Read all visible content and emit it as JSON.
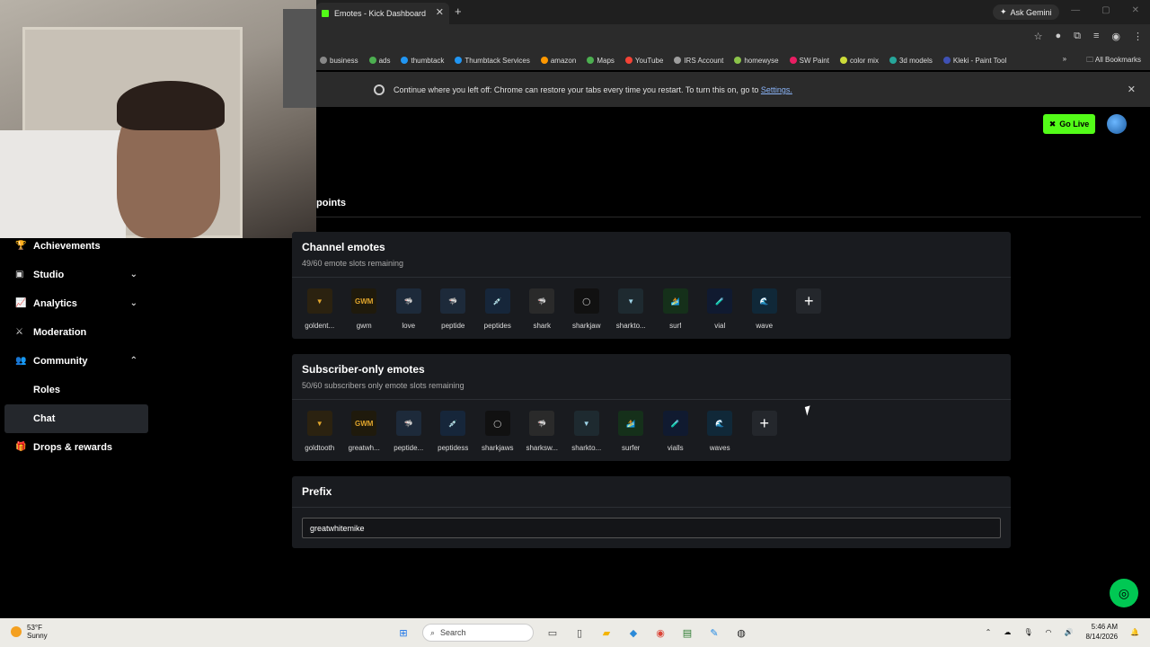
{
  "browser": {
    "tab_title": "Emotes - Kick Dashboard",
    "tab_close": "✕",
    "new_tab": "+",
    "ask_gemini": "Ask Gemini",
    "bookmarks": [
      {
        "label": "business",
        "color": "#888888"
      },
      {
        "label": "ads",
        "color": "#4caf50"
      },
      {
        "label": "thumbtack",
        "color": "#2196f3"
      },
      {
        "label": "Thumbtack Services",
        "color": "#2196f3"
      },
      {
        "label": "amazon",
        "color": "#ff9800"
      },
      {
        "label": "Maps",
        "color": "#4caf50"
      },
      {
        "label": "YouTube",
        "color": "#f44336"
      },
      {
        "label": "IRS Account",
        "color": "#9e9e9e"
      },
      {
        "label": "homewyse",
        "color": "#8bc34a"
      },
      {
        "label": "SW Paint",
        "color": "#e91e63"
      },
      {
        "label": "color mix",
        "color": "#cddc39"
      },
      {
        "label": "3d models",
        "color": "#26a69a"
      },
      {
        "label": "Kleki - Paint Tool",
        "color": "#3f51b5"
      }
    ],
    "bookmarks_overflow": "»",
    "all_bookmarks": "All Bookmarks",
    "infobar_text": "Continue where you left off: Chrome can restore your tabs every time you restart. To turn this on, go to ",
    "infobar_link": "Settings.",
    "infobar_close": "✕"
  },
  "header": {
    "go_live": "Go Live"
  },
  "section_label": "points",
  "sidebar": {
    "items": [
      {
        "label": "Achievements",
        "icon": "trophy-icon",
        "glyph": "🏆",
        "chevron": ""
      },
      {
        "label": "Studio",
        "icon": "camera-icon",
        "glyph": "▣",
        "chevron": "⌄"
      },
      {
        "label": "Analytics",
        "icon": "chart-icon",
        "glyph": "📈",
        "chevron": "⌄"
      },
      {
        "label": "Moderation",
        "icon": "sword-icon",
        "glyph": "⚔",
        "chevron": ""
      },
      {
        "label": "Community",
        "icon": "people-icon",
        "glyph": "👥",
        "chevron": "⌃"
      },
      {
        "label": "Roles",
        "icon": "",
        "glyph": "",
        "chevron": ""
      },
      {
        "label": "Chat",
        "icon": "",
        "glyph": "",
        "chevron": ""
      },
      {
        "label": "Drops & rewards",
        "icon": "gift-icon",
        "glyph": "🎁",
        "chevron": ""
      }
    ]
  },
  "channel_emotes": {
    "title": "Channel emotes",
    "subtitle": "49/60 emote slots remaining",
    "emotes": [
      {
        "label": "goldent...",
        "glyph": "▼",
        "bg": "#2b2210",
        "fg": "#e0a52c"
      },
      {
        "label": "gwm",
        "glyph": "GWM",
        "bg": "#1f1a0c",
        "fg": "#e0a52c"
      },
      {
        "label": "love",
        "glyph": "🦈",
        "bg": "#1d2a3a",
        "fg": "#7ec3ff"
      },
      {
        "label": "peptide",
        "glyph": "🦈",
        "bg": "#1d2a3a",
        "fg": "#7ec3ff"
      },
      {
        "label": "peptides",
        "glyph": "💉",
        "bg": "#16263a",
        "fg": "#5aa8ff"
      },
      {
        "label": "shark",
        "glyph": "🦈",
        "bg": "#2a2a2a",
        "fg": "#cccccc"
      },
      {
        "label": "sharkjaw",
        "glyph": "◯",
        "bg": "#111111",
        "fg": "#e6e6e6"
      },
      {
        "label": "sharkto...",
        "glyph": "▼",
        "bg": "#1e2a30",
        "fg": "#9fd4e8"
      },
      {
        "label": "surf",
        "glyph": "🏄",
        "bg": "#15301a",
        "fg": "#7bd14a"
      },
      {
        "label": "vial",
        "glyph": "🧪",
        "bg": "#101a30",
        "fg": "#4a90ff"
      },
      {
        "label": "wave",
        "glyph": "🌊",
        "bg": "#102838",
        "fg": "#4ab0ff"
      }
    ],
    "add": "+"
  },
  "subscriber_emotes": {
    "title": "Subscriber-only emotes",
    "subtitle": "50/60 subscribers only emote slots remaining",
    "emotes": [
      {
        "label": "goldtooth",
        "glyph": "▼",
        "bg": "#2b2210",
        "fg": "#e0a52c"
      },
      {
        "label": "greatwh...",
        "glyph": "GWM",
        "bg": "#1f1a0c",
        "fg": "#e0a52c"
      },
      {
        "label": "peptide...",
        "glyph": "🦈",
        "bg": "#1d2a3a",
        "fg": "#7ec3ff"
      },
      {
        "label": "peptidess",
        "glyph": "💉",
        "bg": "#16263a",
        "fg": "#5aa8ff"
      },
      {
        "label": "sharkjaws",
        "glyph": "◯",
        "bg": "#111111",
        "fg": "#e6e6e6"
      },
      {
        "label": "sharksw...",
        "glyph": "🦈",
        "bg": "#2a2a2a",
        "fg": "#cccccc"
      },
      {
        "label": "sharkto...",
        "glyph": "▼",
        "bg": "#1e2a30",
        "fg": "#9fd4e8"
      },
      {
        "label": "surfer",
        "glyph": "🏄",
        "bg": "#15301a",
        "fg": "#7bd14a"
      },
      {
        "label": "vialls",
        "glyph": "🧪",
        "bg": "#101a30",
        "fg": "#4a90ff"
      },
      {
        "label": "waves",
        "glyph": "🌊",
        "bg": "#102838",
        "fg": "#4ab0ff"
      }
    ],
    "add": "+"
  },
  "prefix": {
    "title": "Prefix",
    "value": "greatwhitemike"
  },
  "taskbar": {
    "weather_temp": "53°F",
    "weather_desc": "Sunny",
    "search_label": "Search",
    "time": "5:46 AM",
    "date": "8/14/2026"
  },
  "colors": {
    "brand_green": "#53fc18",
    "card_bg": "#191b1f",
    "page_bg": "#000000"
  }
}
